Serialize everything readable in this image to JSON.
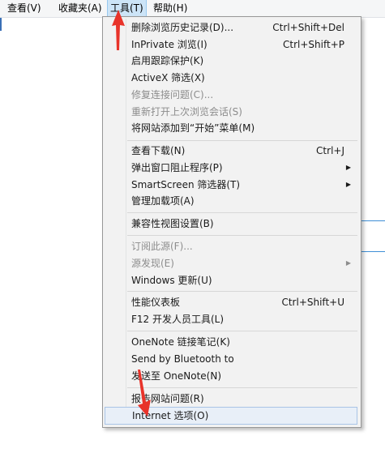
{
  "menubar": {
    "items": [
      {
        "label": "查看(V)",
        "name": "menu-view"
      },
      {
        "label": "收藏夹(A)",
        "name": "menu-favorites"
      },
      {
        "label": "工具(T)",
        "name": "menu-tools"
      },
      {
        "label": "帮助(H)",
        "name": "menu-help"
      }
    ]
  },
  "tools_menu": {
    "items": [
      {
        "label": "删除浏览历史记录(D)...",
        "shortcut": "Ctrl+Shift+Del"
      },
      {
        "label": "InPrivate 浏览(I)",
        "shortcut": "Ctrl+Shift+P"
      },
      {
        "label": "启用跟踪保护(K)"
      },
      {
        "label": "ActiveX 筛选(X)"
      },
      {
        "label": "修复连接问题(C)..."
      },
      {
        "label": "重新打开上次浏览会话(S)"
      },
      {
        "label": "将网站添加到“开始”菜单(M)"
      },
      {
        "label": "查看下载(N)",
        "shortcut": "Ctrl+J"
      },
      {
        "label": "弹出窗口阻止程序(P)"
      },
      {
        "label": "SmartScreen 筛选器(T)"
      },
      {
        "label": "管理加载项(A)"
      },
      {
        "label": "兼容性视图设置(B)"
      },
      {
        "label": "订阅此源(F)..."
      },
      {
        "label": "源发现(E)"
      },
      {
        "label": "Windows 更新(U)"
      },
      {
        "label": "性能仪表板",
        "shortcut": "Ctrl+Shift+U"
      },
      {
        "label": "F12 开发人员工具(L)"
      },
      {
        "label": "OneNote 链接笔记(K)"
      },
      {
        "label": "Send by Bluetooth to"
      },
      {
        "label": "发送至 OneNote(N)"
      },
      {
        "label": "报告网站问题(R)"
      },
      {
        "label": "Internet 选项(O)"
      }
    ]
  },
  "colors": {
    "highlight": "#e8eff8",
    "disabled_text": "#8d8d8d",
    "annotation_arrow": "#e8332a"
  }
}
